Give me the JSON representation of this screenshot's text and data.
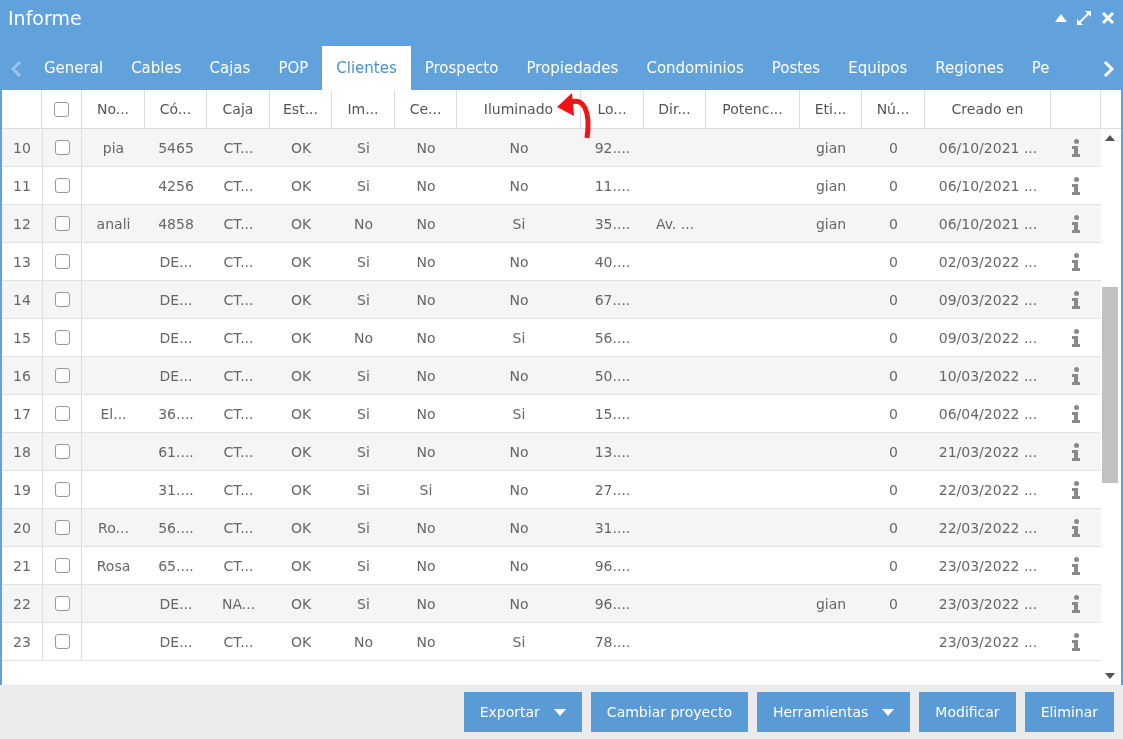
{
  "window": {
    "title": "Informe"
  },
  "tabs": [
    {
      "label": "General",
      "selected": false
    },
    {
      "label": "Cables",
      "selected": false
    },
    {
      "label": "Cajas",
      "selected": false
    },
    {
      "label": "POP",
      "selected": false
    },
    {
      "label": "Clientes",
      "selected": true
    },
    {
      "label": "Prospecto",
      "selected": false
    },
    {
      "label": "Propiedades",
      "selected": false
    },
    {
      "label": "Condominios",
      "selected": false
    },
    {
      "label": "Postes",
      "selected": false
    },
    {
      "label": "Equipos",
      "selected": false
    },
    {
      "label": "Regiones",
      "selected": false
    },
    {
      "label": "Pe",
      "selected": false
    }
  ],
  "table": {
    "select_all_checked": false,
    "columns": [
      "No...",
      "Có...",
      "Caja",
      "Est...",
      "Im...",
      "Ce...",
      "Iluminado",
      "Lo...",
      "Dir...",
      "Potenc...",
      "Eti...",
      "Nú...",
      "Creado en"
    ],
    "rows": [
      {
        "number": "10",
        "checked": false,
        "cells": [
          "pia",
          "5465",
          "CT...",
          "OK",
          "Si",
          "No",
          "No",
          "92....",
          null,
          null,
          "gian",
          "0",
          "06/10/2021 ..."
        ]
      },
      {
        "number": "11",
        "checked": false,
        "cells": [
          null,
          "4256",
          "CT...",
          "OK",
          "Si",
          "No",
          "No",
          "11....",
          null,
          null,
          "gian",
          "0",
          "06/10/2021 ..."
        ]
      },
      {
        "number": "12",
        "checked": false,
        "cells": [
          "anali",
          "4858",
          "CT...",
          "OK",
          "No",
          "No",
          "Si",
          "35....",
          "Av. ...",
          null,
          "gian",
          "0",
          "06/10/2021 ..."
        ]
      },
      {
        "number": "13",
        "checked": false,
        "cells": [
          null,
          "DE...",
          "CT...",
          "OK",
          "Si",
          "No",
          "No",
          "40....",
          null,
          null,
          null,
          "0",
          "02/03/2022 ..."
        ]
      },
      {
        "number": "14",
        "checked": false,
        "cells": [
          null,
          "DE...",
          "CT...",
          "OK",
          "Si",
          "No",
          "No",
          "67....",
          null,
          null,
          null,
          "0",
          "09/03/2022 ..."
        ]
      },
      {
        "number": "15",
        "checked": false,
        "cells": [
          null,
          "DE...",
          "CT...",
          "OK",
          "No",
          "No",
          "Si",
          "56....",
          null,
          null,
          null,
          "0",
          "09/03/2022 ..."
        ]
      },
      {
        "number": "16",
        "checked": false,
        "cells": [
          null,
          "DE...",
          "CT...",
          "OK",
          "Si",
          "No",
          "No",
          "50....",
          null,
          null,
          null,
          "0",
          "10/03/2022 ..."
        ]
      },
      {
        "number": "17",
        "checked": false,
        "cells": [
          "El...",
          "36....",
          "CT...",
          "OK",
          "Si",
          "No",
          "Si",
          "15....",
          null,
          null,
          null,
          "0",
          "06/04/2022 ..."
        ]
      },
      {
        "number": "18",
        "checked": false,
        "cells": [
          null,
          "61....",
          "CT...",
          "OK",
          "Si",
          "No",
          "No",
          "13....",
          null,
          null,
          null,
          "0",
          "21/03/2022 ..."
        ]
      },
      {
        "number": "19",
        "checked": false,
        "cells": [
          null,
          "31....",
          "CT...",
          "OK",
          "Si",
          "Si",
          "No",
          "27....",
          null,
          null,
          null,
          "0",
          "22/03/2022 ..."
        ]
      },
      {
        "number": "20",
        "checked": false,
        "cells": [
          "Ro...",
          "56....",
          "CT...",
          "OK",
          "Si",
          "No",
          "No",
          "31....",
          null,
          null,
          null,
          "0",
          "22/03/2022 ..."
        ]
      },
      {
        "number": "21",
        "checked": false,
        "cells": [
          "Rosa",
          "65....",
          "CT...",
          "OK",
          "Si",
          "No",
          "No",
          "96....",
          null,
          null,
          null,
          "0",
          "23/03/2022 ..."
        ]
      },
      {
        "number": "22",
        "checked": false,
        "cells": [
          null,
          "DE...",
          "NA...",
          "OK",
          "Si",
          "No",
          "No",
          "96....",
          null,
          null,
          "gian",
          "0",
          "23/03/2022 ..."
        ]
      },
      {
        "number": "23",
        "checked": false,
        "cells": [
          null,
          "DE...",
          "CT...",
          "OK",
          "No",
          "No",
          "Si",
          "78....",
          null,
          null,
          null,
          null,
          "23/03/2022 ..."
        ]
      }
    ]
  },
  "buttons": [
    {
      "label": "Exportar",
      "dropdown": true
    },
    {
      "label": "Cambiar proyecto",
      "dropdown": false
    },
    {
      "label": "Herramientas",
      "dropdown": true
    },
    {
      "label": "Modificar",
      "dropdown": false
    },
    {
      "label": "Eliminar",
      "dropdown": false
    }
  ]
}
